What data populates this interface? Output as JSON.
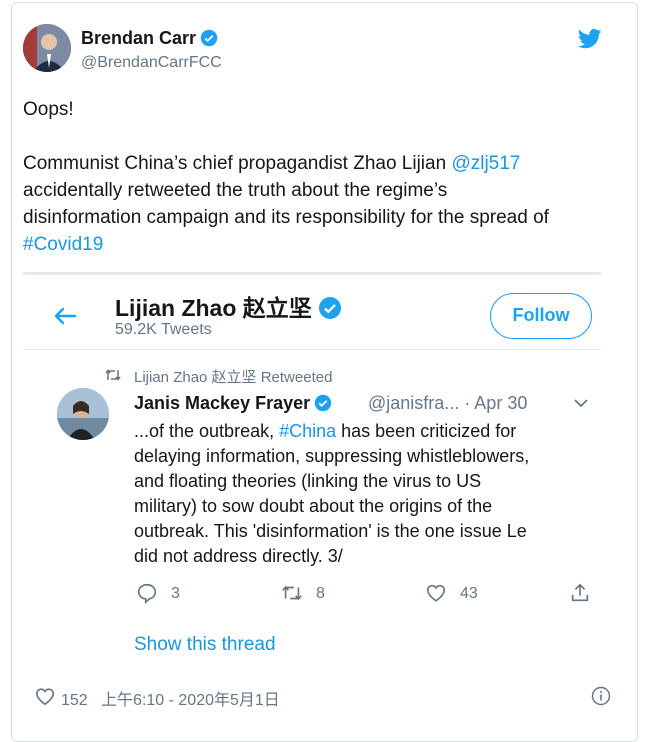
{
  "tweet": {
    "author_name": "Brendan Carr",
    "author_handle": "@BrendanCarrFCC",
    "text_lines": [
      {
        "before": "Oops!",
        "link": "",
        "after": ""
      },
      {
        "before": "",
        "link": "",
        "after": ""
      },
      {
        "before": "Communist China’s chief propagandist Zhao Lijian ",
        "link": "@zlj517",
        "after": ""
      },
      {
        "before": "accidentally retweeted the truth about the regime’s",
        "link": "",
        "after": ""
      },
      {
        "before": "disinformation campaign and its responsibility for the spread of",
        "link": "",
        "after": ""
      },
      {
        "before": "",
        "link": "#Covid19",
        "after": ""
      }
    ],
    "likes": "152",
    "timestamp": "上午6:10 - 2020年5月1日"
  },
  "screenshot": {
    "profile_name": "Lijian Zhao 赵立坚",
    "tweet_count": "59.2K Tweets",
    "follow_label": "Follow",
    "retweeted_label": "Lijian Zhao 赵立坚 Retweeted",
    "inner_author": "Janis Mackey Frayer",
    "inner_meta": "@janisfra... · Apr 30",
    "inner_text_lines": [
      {
        "before": "...of the outbreak, ",
        "link": "#China",
        "after": " has been criticized for"
      },
      {
        "before": "delaying information, suppressing whistleblowers,",
        "link": "",
        "after": ""
      },
      {
        "before": "and floating theories (linking the virus to US",
        "link": "",
        "after": ""
      },
      {
        "before": "military) to sow doubt about the origins of the",
        "link": "",
        "after": ""
      },
      {
        "before": "outbreak. This 'disinformation' is the one issue Le",
        "link": "",
        "after": ""
      },
      {
        "before": "did not address directly. 3/",
        "link": "",
        "after": ""
      }
    ],
    "replies": "3",
    "retweets": "8",
    "likes": "43",
    "show_thread": "Show this thread"
  },
  "colors": {
    "accent": "#1da1f2",
    "link": "#1b95e0",
    "muted": "#657786"
  },
  "icons": [
    "verified-badge-icon",
    "twitter-bird-icon",
    "back-arrow-icon",
    "retweet-icon",
    "chevron-down-icon",
    "reply-icon",
    "heart-icon",
    "share-icon",
    "info-icon"
  ]
}
